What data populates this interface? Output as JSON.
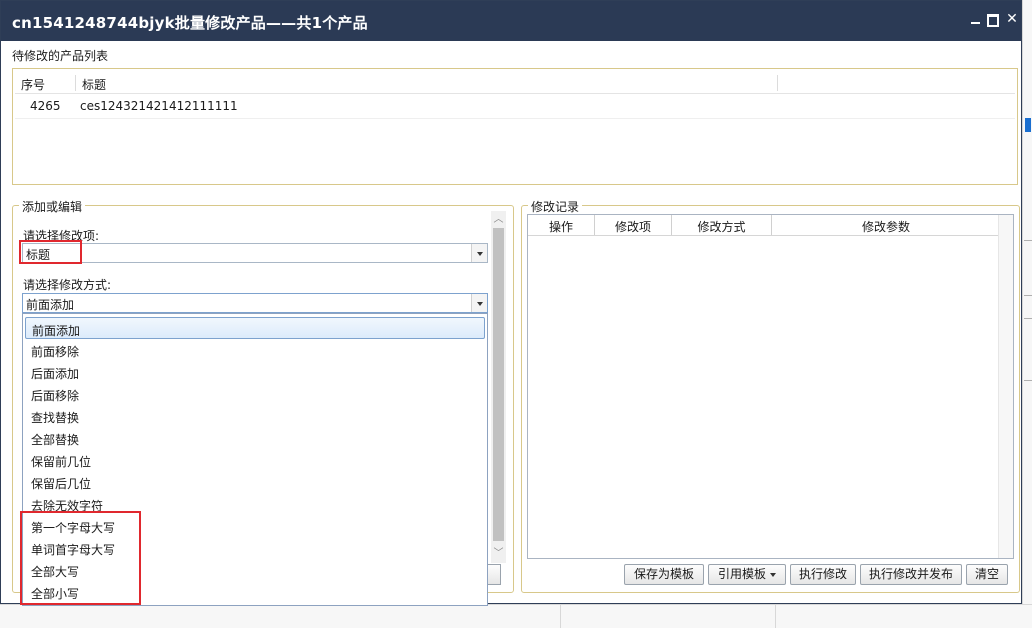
{
  "window": {
    "title": "cn1541248744bjyk批量修改产品——共1个产品",
    "close_glyph": "✕"
  },
  "product_list": {
    "label": "待修改的产品列表",
    "columns": [
      "序号",
      "标题"
    ],
    "rows": [
      {
        "id": "4265",
        "title": "ces124321421412111111"
      }
    ]
  },
  "edit_panel": {
    "legend": "添加或编辑",
    "field_label": "请选择修改项:",
    "field_value": "标题",
    "method_label": "请选择修改方式:",
    "method_value": "前面添加",
    "method_options": [
      "前面添加",
      "前面移除",
      "后面添加",
      "后面移除",
      "查找替换",
      "全部替换",
      "保留前几位",
      "保留后几位",
      "去除无效字符",
      "第一个字母大写",
      "单词首字母大写",
      "全部大写",
      "全部小写"
    ],
    "selected_option_index": 0,
    "scroll_up": "︿",
    "scroll_down": "﹀"
  },
  "log_panel": {
    "legend": "修改记录",
    "columns": [
      "操作",
      "修改项",
      "修改方式",
      "修改参数"
    ]
  },
  "buttons": {
    "save_template": "保存为模板",
    "use_template": "引用模板",
    "execute": "执行修改",
    "execute_publish": "执行修改并发布",
    "clear": "清空"
  },
  "colors": {
    "titlebar": "#2b3a55",
    "group_border": "#d8c88a",
    "highlight": "#e0282e"
  }
}
